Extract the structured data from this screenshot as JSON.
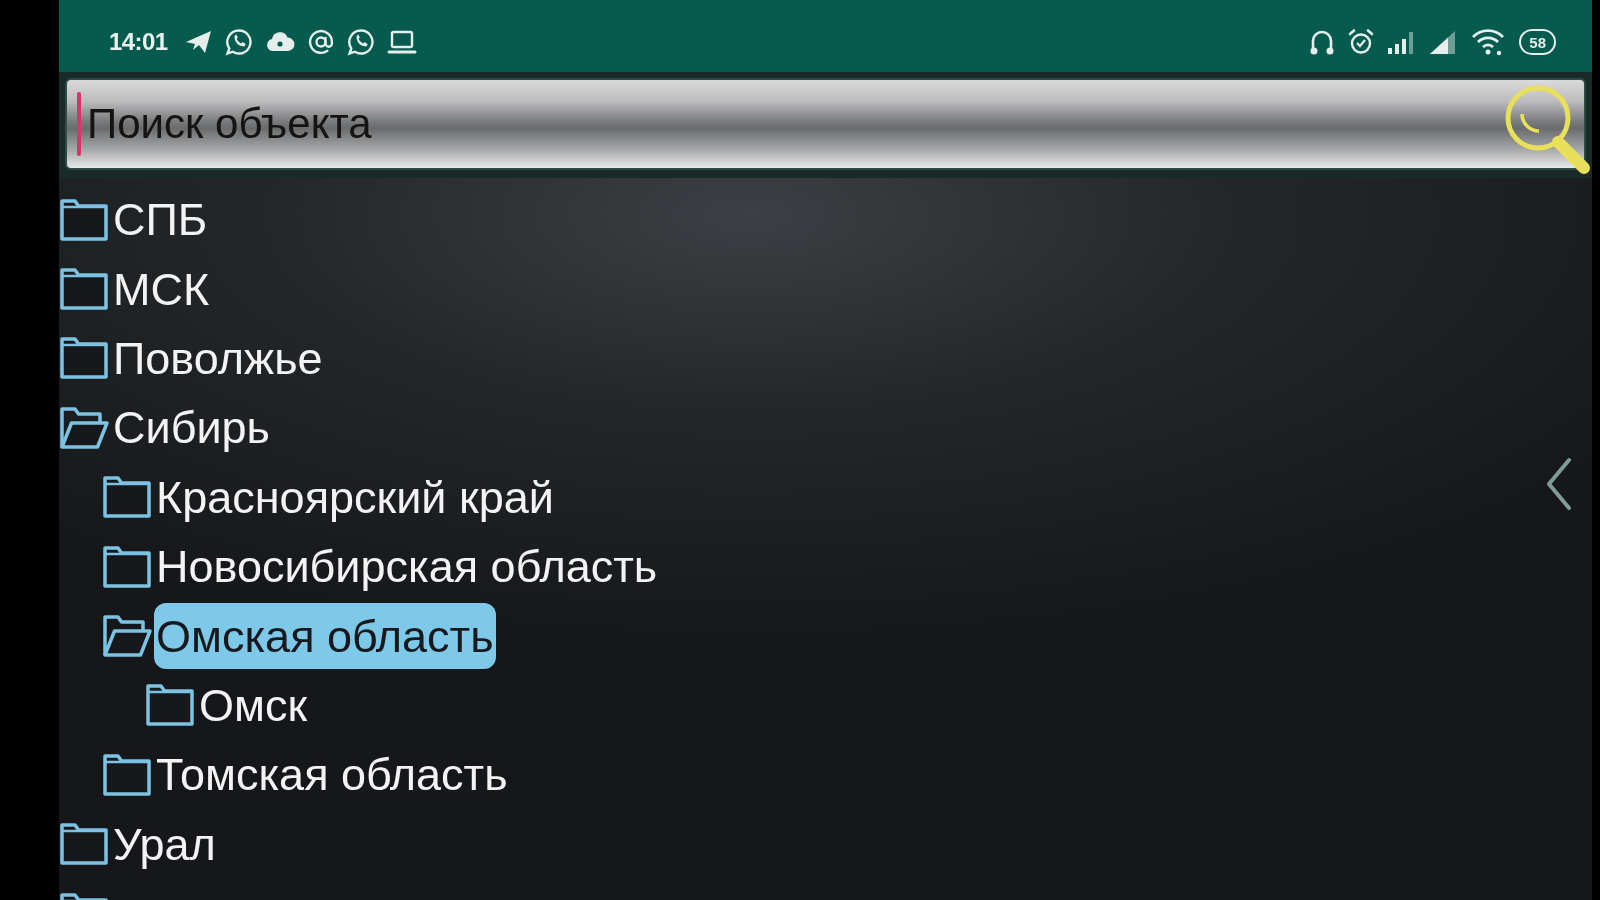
{
  "status_bar": {
    "time": "14:01",
    "battery": "58"
  },
  "search": {
    "placeholder": "Поиск объекта"
  },
  "tree": [
    {
      "label": "СПБ",
      "expanded": false,
      "selected": false
    },
    {
      "label": "МСК",
      "expanded": false,
      "selected": false
    },
    {
      "label": "Поволжье",
      "expanded": false,
      "selected": false
    },
    {
      "label": "Сибирь",
      "expanded": true,
      "selected": false,
      "children": [
        {
          "label": "Красноярский край",
          "expanded": false,
          "selected": false
        },
        {
          "label": "Новосибирская область",
          "expanded": false,
          "selected": false
        },
        {
          "label": "Омская область",
          "expanded": true,
          "selected": true,
          "children": [
            {
              "label": "Омск",
              "expanded": false,
              "selected": false
            }
          ]
        },
        {
          "label": "Томская область",
          "expanded": false,
          "selected": false
        }
      ]
    },
    {
      "label": "Урал",
      "expanded": false,
      "selected": false
    },
    {
      "expanded": false
    }
  ]
}
